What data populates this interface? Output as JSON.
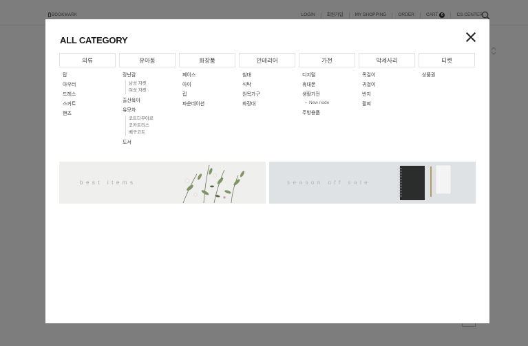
{
  "background": {
    "logo": "BOOKMARK",
    "nav": [
      "LOGIN",
      "회원가입",
      "MY SHOPPING",
      "ORDER",
      "CART",
      "CS CENTER"
    ],
    "cart_count": "0"
  },
  "modal": {
    "title": "ALL CATEGORY",
    "tabs": [
      "의류",
      "유아동",
      "화장품",
      "인테리어",
      "가전",
      "악세사리",
      "티켓"
    ],
    "columns": {
      "c0": {
        "items": [
          "탑",
          "아우터",
          "드레스",
          "스커트",
          "팬츠"
        ]
      },
      "c1": {
        "toy": "장난감",
        "toy_subs": [
          "남성 자켓",
          "여성 자켓"
        ],
        "childcare": "출산육아",
        "stroller": "유모차",
        "stroller_subs": [
          "코트디부아르",
          "코카트리스",
          "베구코트"
        ],
        "books": "도서"
      },
      "c2": {
        "items": [
          "페이스",
          "아이",
          "립",
          "파운데이션"
        ]
      },
      "c3": {
        "items": [
          "침대",
          "식탁",
          "원목가구",
          "화장대"
        ]
      },
      "c4": {
        "digital": "디지털",
        "phone": "휴대폰",
        "appliance": "생활가전",
        "appliance_subs": [
          "New node"
        ],
        "kitchen": "주방용품"
      },
      "c5": {
        "items": [
          "목걸이",
          "귀걸이",
          "반지",
          "팔찌"
        ]
      },
      "c6": {
        "items": [
          "상품권"
        ]
      }
    },
    "banners": [
      "best items",
      "season off sale"
    ]
  },
  "colors": {
    "overlay": "#7d7d7d",
    "modal_bg": "#ffffff",
    "tab_border": "#e2e2e2"
  }
}
